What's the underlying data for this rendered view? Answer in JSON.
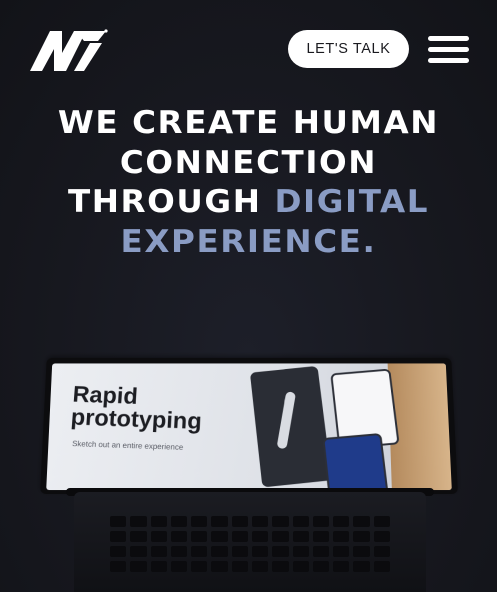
{
  "header": {
    "logo_icon": "n7-logo-icon",
    "cta_label": "LET'S TALK",
    "menu_icon": "hamburger-menu-icon"
  },
  "hero": {
    "line1": "WE CREATE HUMAN",
    "line2": "CONNECTION",
    "line3_plain": "THROUGH ",
    "line3_accent": "DIGITAL",
    "line4_accent": "EXPERIENCE."
  },
  "laptop_screen": {
    "title_line1": "Rapid",
    "title_line2": "prototyping",
    "subtitle": "Sketch out an entire experience"
  },
  "colors": {
    "background": "#17181f",
    "accent": "#8a9cc4",
    "text": "#ffffff",
    "button_bg": "#ffffff"
  }
}
